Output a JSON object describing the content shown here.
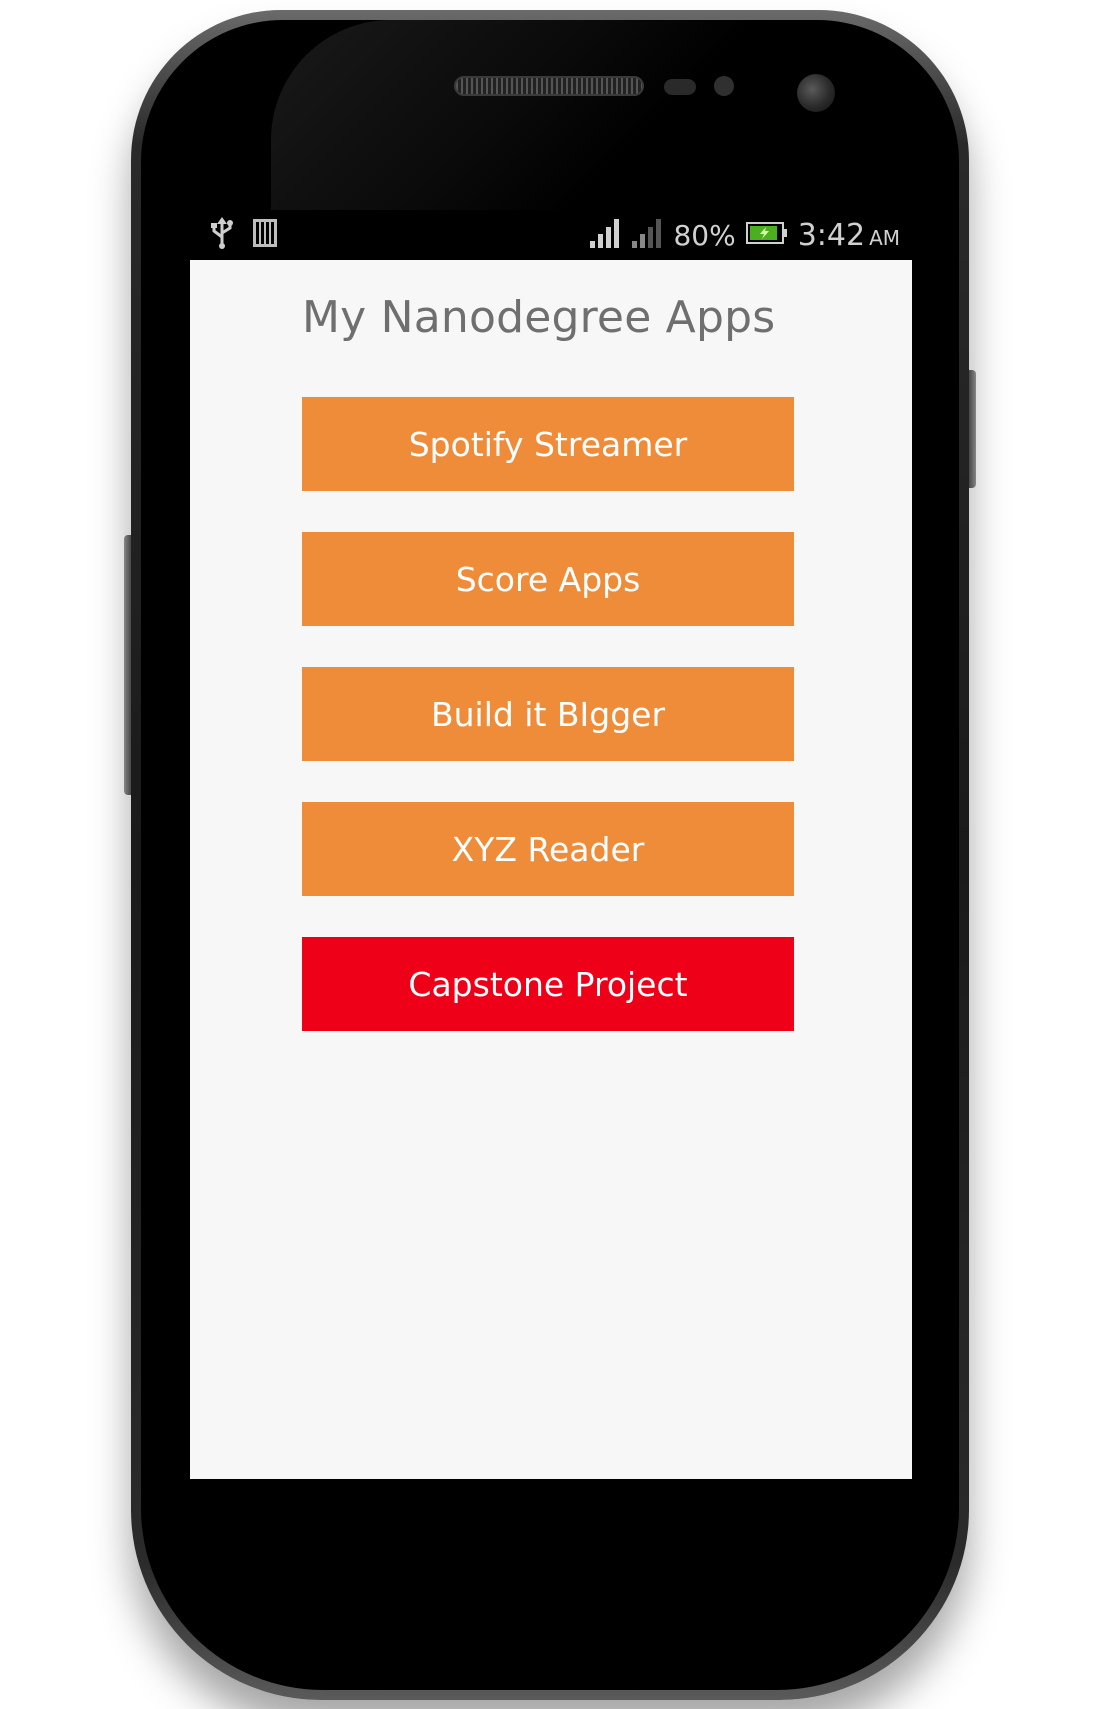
{
  "status_bar": {
    "icons_left": [
      "usb-icon",
      "sim-card-icon"
    ],
    "icons_right": [
      "signal-strength-icon",
      "signal-strength-icon-2",
      "battery-charging-icon"
    ],
    "battery_percent": "80%",
    "time": "3:42",
    "ampm": "AM"
  },
  "app": {
    "title": "My Nanodegree Apps",
    "buttons": [
      {
        "label": "Spotify Streamer",
        "color": "#ef8c39"
      },
      {
        "label": "Score Apps",
        "color": "#ef8c39"
      },
      {
        "label": "Build it BIgger",
        "color": "#ef8c39"
      },
      {
        "label": "XYZ Reader",
        "color": "#ef8c39"
      },
      {
        "label": "Capstone Project",
        "color": "#ee0019"
      }
    ]
  },
  "colors": {
    "accent_orange": "#ef8c39",
    "accent_red": "#ee0019",
    "screen_background": "#f7f7f7",
    "title_text": "#6f6f6f"
  }
}
